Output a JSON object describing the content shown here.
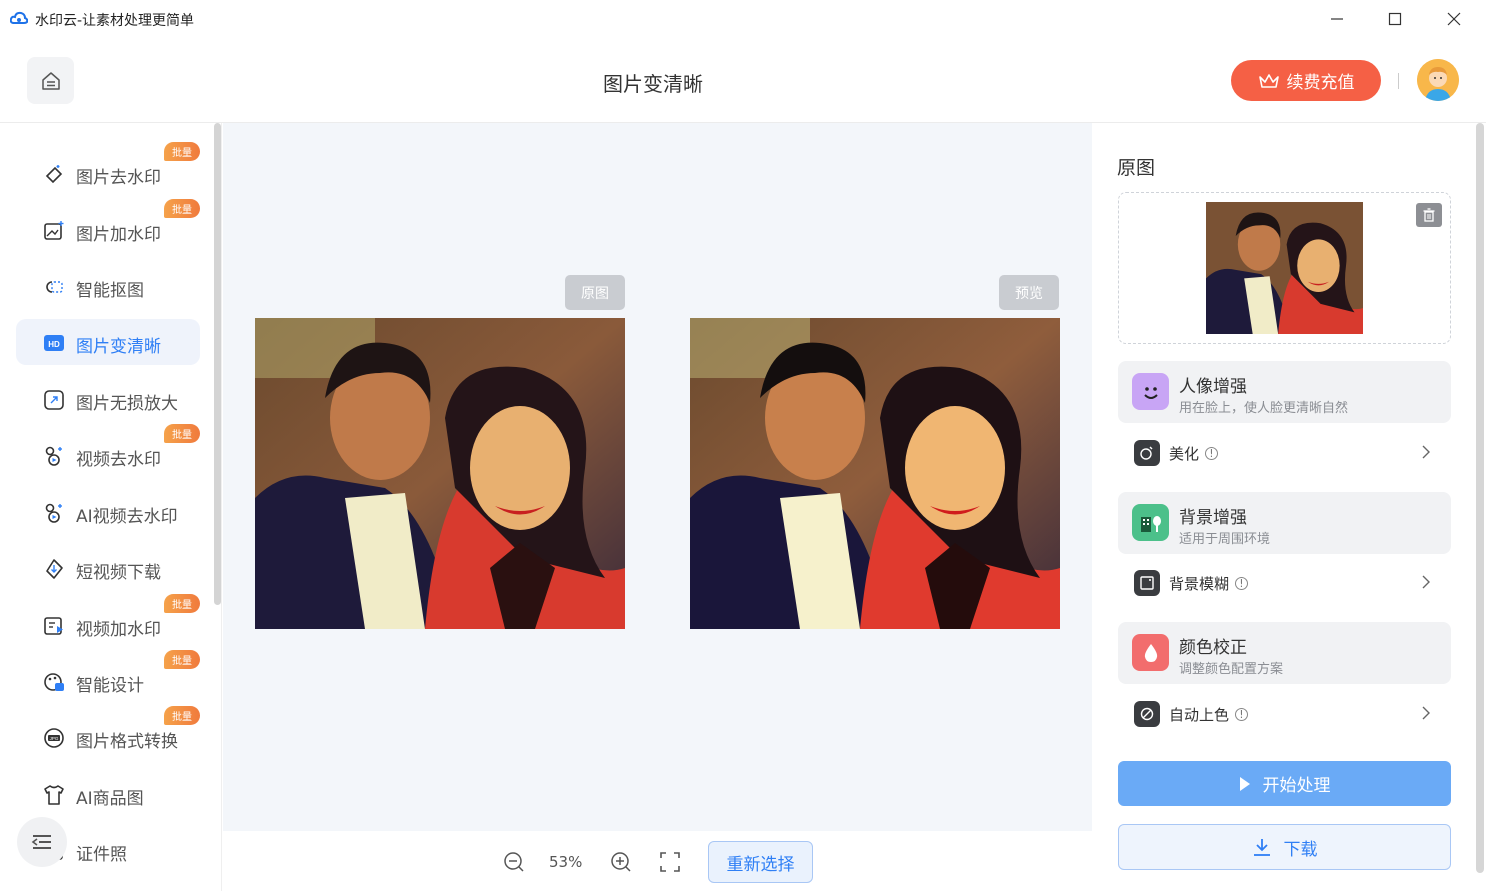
{
  "window": {
    "title": "水印云-让素材处理更简单"
  },
  "header": {
    "page_title": "图片变清晰",
    "vip_label": "续费充值"
  },
  "sidebar": {
    "items": [
      {
        "label": "图片去水印",
        "icon": "eraser-icon",
        "badge": "批量"
      },
      {
        "label": "图片加水印",
        "icon": "image-add-icon",
        "badge": "批量"
      },
      {
        "label": "智能抠图",
        "icon": "cutout-icon",
        "badge": ""
      },
      {
        "label": "图片变清晰",
        "icon": "hd-icon",
        "badge": "",
        "active": true
      },
      {
        "label": "图片无损放大",
        "icon": "enlarge-icon",
        "badge": ""
      },
      {
        "label": "视频去水印",
        "icon": "video-eraser-icon",
        "badge": "批量"
      },
      {
        "label": "AI视频去水印",
        "icon": "ai-video-icon",
        "badge": ""
      },
      {
        "label": "短视频下载",
        "icon": "download-video-icon",
        "badge": ""
      },
      {
        "label": "视频加水印",
        "icon": "video-add-icon",
        "badge": "批量"
      },
      {
        "label": "智能设计",
        "icon": "design-icon",
        "badge": "批量"
      },
      {
        "label": "图片格式转换",
        "icon": "jpg-convert-icon",
        "badge": "批量"
      },
      {
        "label": "AI商品图",
        "icon": "tshirt-icon",
        "badge": ""
      },
      {
        "label": "证件照",
        "icon": "id-photo-icon",
        "badge": ""
      }
    ],
    "hd_icon_text": "HD",
    "jpg_icon_text": "JPG"
  },
  "canvas": {
    "original_tag": "原图",
    "preview_tag": "预览"
  },
  "bottombar": {
    "zoom_level": "53%",
    "reselect_label": "重新选择"
  },
  "right_panel": {
    "original_title": "原图",
    "features": [
      {
        "title": "人像增强",
        "desc": "用在脸上，使人脸更清晰自然",
        "icon": "face-icon",
        "color": "#c8a5f5"
      },
      {
        "title": "背景增强",
        "desc": "适用于周围环境",
        "icon": "building-icon",
        "color": "#4cc08a"
      },
      {
        "title": "颜色校正",
        "desc": "调整颜色配置方案",
        "icon": "drop-icon",
        "color": "#f26d6d"
      }
    ],
    "options": [
      {
        "label": "美化",
        "info": "!",
        "icon": "beauty-icon"
      },
      {
        "label": "背景模糊",
        "info": "!",
        "icon": "blur-icon"
      },
      {
        "label": "自动上色",
        "info": "!",
        "icon": "colorize-icon"
      }
    ],
    "start_label": "开始处理",
    "download_label": "下载"
  },
  "colors": {
    "accent": "#2f7ff5",
    "vip": "#f56045",
    "start": "#6aaaf6",
    "badge": "#f08a3d"
  }
}
